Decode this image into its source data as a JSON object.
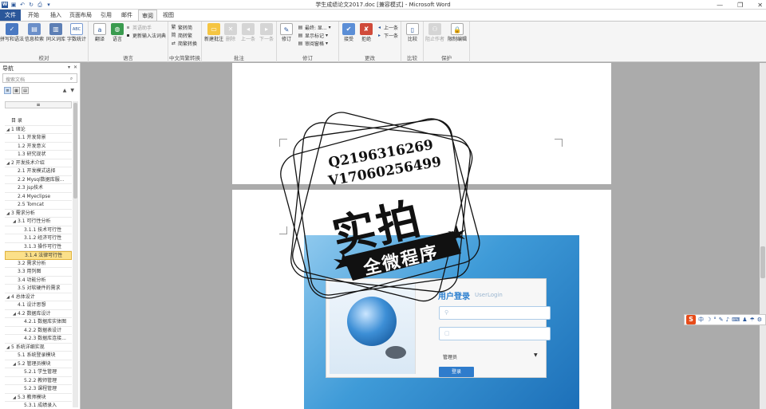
{
  "titlebar": {
    "app_icon": "word-icon",
    "title": "学生成绩论文2017.doc [兼容模式] - Microsoft Word",
    "qat": [
      "save-icon",
      "undo-icon",
      "redo-icon",
      "print-icon"
    ],
    "controls": [
      "minimize-icon",
      "restore-icon",
      "close-icon"
    ]
  },
  "tabs": [
    {
      "label": "文件",
      "kind": "file"
    },
    {
      "label": "开始"
    },
    {
      "label": "插入"
    },
    {
      "label": "页面布局"
    },
    {
      "label": "引用"
    },
    {
      "label": "邮件"
    },
    {
      "label": "审阅",
      "kind": "selected"
    },
    {
      "label": "视图"
    }
  ],
  "ribbon": {
    "groups": [
      {
        "label": "校对",
        "buttons": [
          {
            "label": "拼写和语法",
            "icon": "abc-check-icon"
          },
          {
            "label": "信息检索",
            "icon": "research-book-icon"
          },
          {
            "label": "同义词库",
            "icon": "thesaurus-icon"
          },
          {
            "label": "字数统计",
            "icon": "word-count-icon"
          }
        ]
      },
      {
        "label": "语言",
        "buttons": [
          {
            "label": "翻译",
            "icon": "translate-icon"
          },
          {
            "label": "语言",
            "icon": "language-globe-icon"
          }
        ],
        "small": [
          {
            "label": "英语助手",
            "icon": "english-assistant-icon",
            "disabled": true
          },
          {
            "label": "更新输入法词典",
            "icon": "ime-dictionary-icon"
          }
        ]
      },
      {
        "label": "中文简繁转换",
        "small": [
          {
            "label": "繁转简",
            "icon": "trad-to-simp-icon"
          },
          {
            "label": "简转繁",
            "icon": "simp-to-trad-icon"
          },
          {
            "label": "简繁转换",
            "icon": "convert-icon"
          }
        ]
      },
      {
        "label": "批注",
        "buttons": [
          {
            "label": "新建批注",
            "icon": "new-comment-icon"
          },
          {
            "label": "删除",
            "icon": "delete-comment-icon",
            "disabled": true
          },
          {
            "label": "上一条",
            "icon": "previous-comment-icon",
            "disabled": true
          },
          {
            "label": "下一条",
            "icon": "next-comment-icon",
            "disabled": true
          }
        ]
      },
      {
        "label": "修订",
        "buttons": [
          {
            "label": "修订",
            "icon": "track-changes-icon"
          }
        ],
        "small": [
          {
            "label": "最终: 显...",
            "icon": "display-markup-icon"
          },
          {
            "label": "显示标记",
            "icon": "show-markup-icon"
          },
          {
            "label": "审阅窗格",
            "icon": "reviewing-pane-icon"
          }
        ]
      },
      {
        "label": "更改",
        "buttons": [
          {
            "label": "接受",
            "icon": "accept-icon"
          },
          {
            "label": "拒绝",
            "icon": "reject-icon"
          }
        ],
        "small": [
          {
            "label": "上一条",
            "icon": "previous-change-icon"
          },
          {
            "label": "下一条",
            "icon": "next-change-icon"
          }
        ]
      },
      {
        "label": "比较",
        "buttons": [
          {
            "label": "比较",
            "icon": "compare-icon"
          }
        ]
      },
      {
        "label": "保护",
        "buttons": [
          {
            "label": "阻止作者",
            "icon": "block-authors-icon",
            "disabled": true
          },
          {
            "label": "限制编辑",
            "icon": "restrict-editing-icon"
          }
        ]
      }
    ]
  },
  "nav": {
    "title": "导航",
    "controls": [
      "dropdown-icon",
      "close-icon"
    ],
    "search_placeholder": "搜索文档",
    "view_tabs": [
      "headings-view-icon",
      "pages-view-icon",
      "results-view-icon"
    ],
    "collapse_label": "≡",
    "items": [
      {
        "label": "目  录",
        "level": 0
      },
      {
        "label": "1  绪论",
        "level": 0,
        "toggle": true
      },
      {
        "label": "1.1  开发背景",
        "level": 1
      },
      {
        "label": "1.2  开发意义",
        "level": 1
      },
      {
        "label": "1.3  研究现状",
        "level": 1
      },
      {
        "label": "2  开发技术介绍",
        "level": 0,
        "toggle": true
      },
      {
        "label": "2.1  开发模式选择",
        "level": 1
      },
      {
        "label": "2.2  Mysql数据库服...",
        "level": 1
      },
      {
        "label": "2.3  jsp技术",
        "level": 1
      },
      {
        "label": "2.4  Myeclipse",
        "level": 1
      },
      {
        "label": "2.5  Tomcat",
        "level": 1
      },
      {
        "label": "3  需求分析",
        "level": 0,
        "toggle": true
      },
      {
        "label": "3.1  可行性分析",
        "level": 1,
        "toggle": true
      },
      {
        "label": "3.1.1  技术可行性",
        "level": 2
      },
      {
        "label": "3.1.2  经济可行性",
        "level": 2
      },
      {
        "label": "3.1.3  操作可行性",
        "level": 2
      },
      {
        "label": "3.1.4  法律可行性",
        "level": 2,
        "selected": true
      },
      {
        "label": "3.2  需求分析",
        "level": 1
      },
      {
        "label": "3.3  用列图",
        "level": 1
      },
      {
        "label": "3.4  功能分析",
        "level": 1
      },
      {
        "label": "3.5  对软硬件的需求",
        "level": 1
      },
      {
        "label": "4  总体设计",
        "level": 0,
        "toggle": true
      },
      {
        "label": "4.1  设计思想",
        "level": 1
      },
      {
        "label": "4.2  数据库设计",
        "level": 1,
        "toggle": true
      },
      {
        "label": "4.2.1  数据库实体图",
        "level": 2
      },
      {
        "label": "4.2.2  数据表设计",
        "level": 2
      },
      {
        "label": "4.2.3  数据库连接...",
        "level": 2
      },
      {
        "label": "5  系统详细实现",
        "level": 0,
        "toggle": true
      },
      {
        "label": "5.1  系统登录模块",
        "level": 1
      },
      {
        "label": "5.2  管理员模块",
        "level": 1,
        "toggle": true
      },
      {
        "label": "5.2.1  学生管理",
        "level": 2
      },
      {
        "label": "5.2.2  教师管理",
        "level": 2
      },
      {
        "label": "5.2.3  课程管理",
        "level": 2
      },
      {
        "label": "5.3  教师模块",
        "level": 1,
        "toggle": true
      },
      {
        "label": "5.3.1  成绩录入",
        "level": 2
      }
    ]
  },
  "document": {
    "login_screenshot": {
      "title": "用户登录",
      "subtitle": "UserLogin",
      "username_icon": "user-icon",
      "password_icon": "lock-icon",
      "role_value": "管理员",
      "role_arrow": "▼",
      "login_button": "登录"
    }
  },
  "watermark": {
    "line1": "Q2196316269",
    "line2": "V17060256499",
    "big": "实拍",
    "banner": "全微程序"
  },
  "ime_bar": {
    "logo": "S",
    "items": [
      "中",
      "☽",
      "°",
      "✎",
      "♪",
      "⌨",
      "♟",
      "☂",
      "⚙"
    ]
  },
  "colors": {
    "word_blue": "#2b579a",
    "selected_item": "#fbe08a",
    "login_blue": "#2f7ccc"
  }
}
